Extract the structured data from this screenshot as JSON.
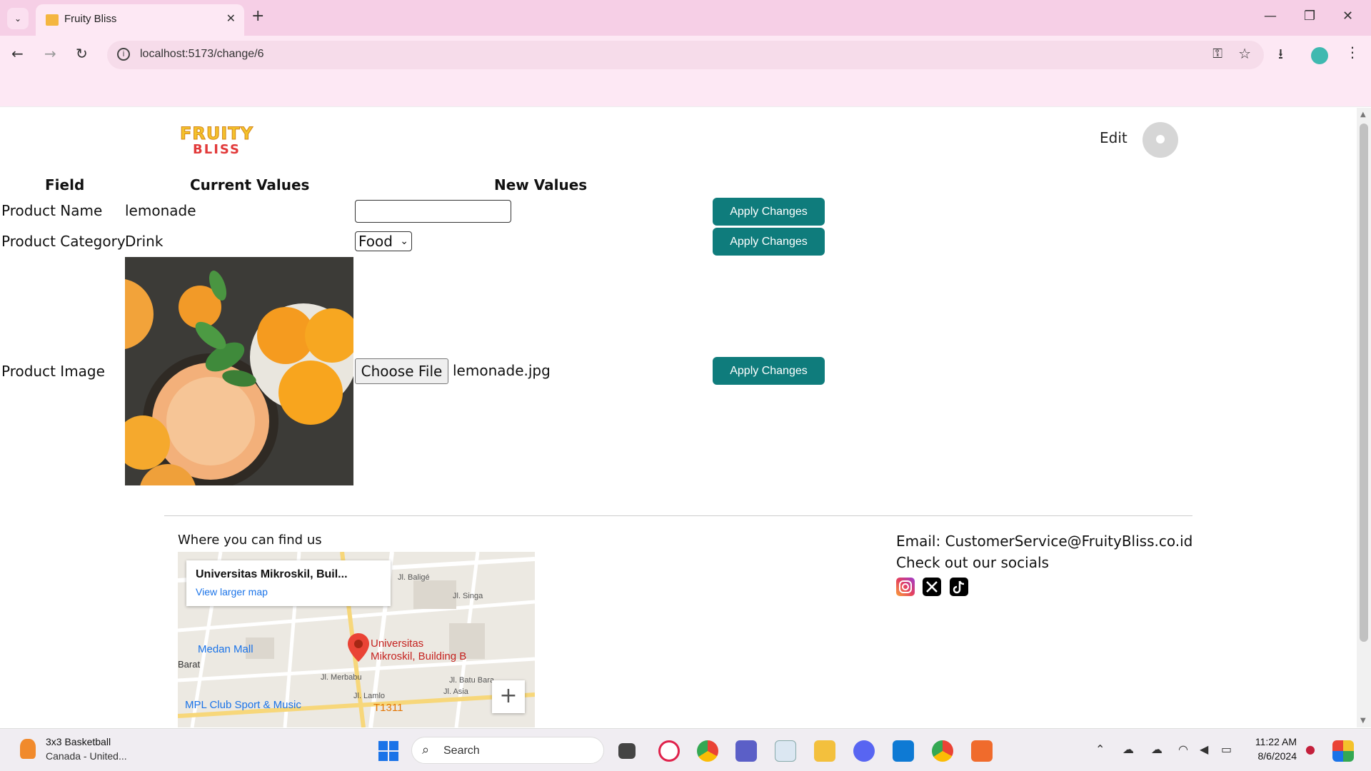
{
  "browser": {
    "tab_title": "Fruity Bliss",
    "url": "localhost:5173/change/6"
  },
  "header": {
    "logo_line1": "FRUITY",
    "logo_line2": "BLISS",
    "edit_label": "Edit"
  },
  "table": {
    "headers": {
      "field": "Field",
      "current": "Current Values",
      "new": "New Values"
    },
    "rows": [
      {
        "field": "Product Name",
        "current": "lemonade",
        "button": "Apply Changes"
      },
      {
        "field": "Product Category",
        "current": "Drink",
        "select_value": "Food",
        "button": "Apply Changes"
      },
      {
        "field": "Product Image",
        "choose_label": "Choose File",
        "file_name": "lemonade.jpg",
        "button": "Apply Changes"
      }
    ]
  },
  "footer": {
    "find_us": "Where you can find us",
    "map": {
      "card_title": "Universitas Mikroskil, Buil...",
      "card_link": "View larger map",
      "pin_label_1": "Universitas",
      "pin_label_2": "Mikroskil, Building B",
      "labels": [
        "Medan Mall",
        "MPL Club Sport & Music",
        "T1311",
        "Jl. Singa",
        "Jl. Batu Bara",
        "Jl. Asia",
        "Jl. Baligé",
        "Barat",
        "Jl. Merbabu",
        "Jl. Lamlo"
      ]
    },
    "email": "Email: CustomerService@FruityBliss.co.id",
    "socials_heading": "Check out our socials",
    "socials": [
      "instagram-icon",
      "x-icon",
      "tiktok-icon"
    ]
  },
  "taskbar": {
    "weather_title": "3x3 Basketball",
    "weather_sub": "Canada - United...",
    "search": "Search",
    "time": "11:22 AM",
    "date": "8/6/2024"
  },
  "colors": {
    "accent": "#0f7c7c",
    "chrome": "#f6cfe6"
  }
}
